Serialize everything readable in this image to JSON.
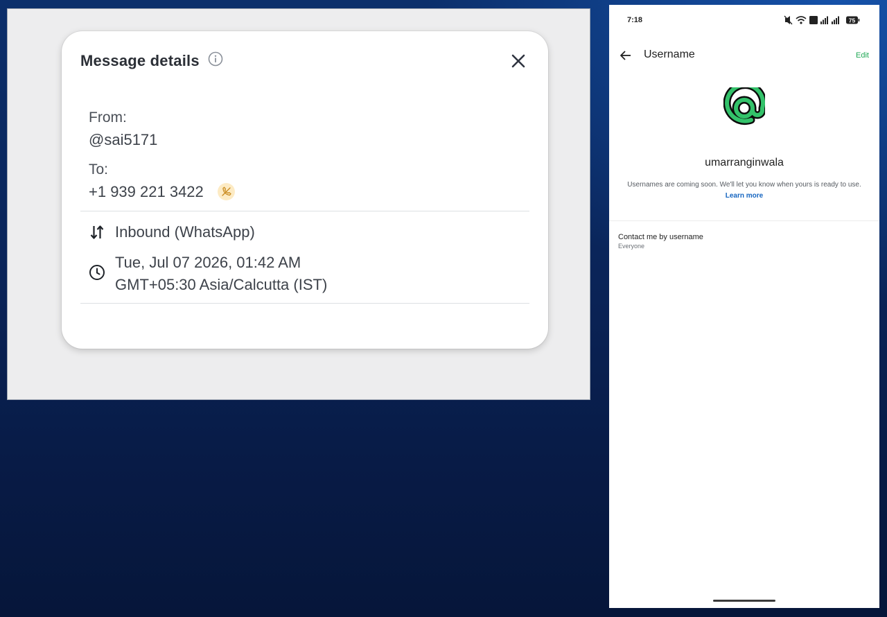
{
  "message_details": {
    "title": "Message details",
    "from_label": "From:",
    "from_value": "@sai5171",
    "to_label": "To:",
    "to_value": "+1 939 221 3422",
    "direction": "Inbound (WhatsApp)",
    "date_line1": "Tue, Jul 07 2026, 01:42 AM",
    "date_line2": "GMT+05:30 Asia/Calcutta (IST)",
    "icons": {
      "info": "info-icon",
      "close": "close-icon",
      "no_call": "phone-slash-icon",
      "direction": "arrows-up-down-icon",
      "time": "clock-icon"
    }
  },
  "phone": {
    "status_bar": {
      "time": "7:18",
      "battery": "75"
    },
    "header": {
      "title": "Username",
      "edit_label": "Edit"
    },
    "username": "umarranginwala",
    "notice": "Usernames are coming soon. We'll let you know when yours is ready to use.",
    "learn_more": "Learn more",
    "setting": {
      "title": "Contact me by username",
      "value": "Everyone"
    }
  },
  "colors": {
    "accent_green": "#1fa855",
    "link_blue": "#1565c0",
    "badge_bg": "#fdebc4",
    "badge_icon": "#c98a1e"
  }
}
